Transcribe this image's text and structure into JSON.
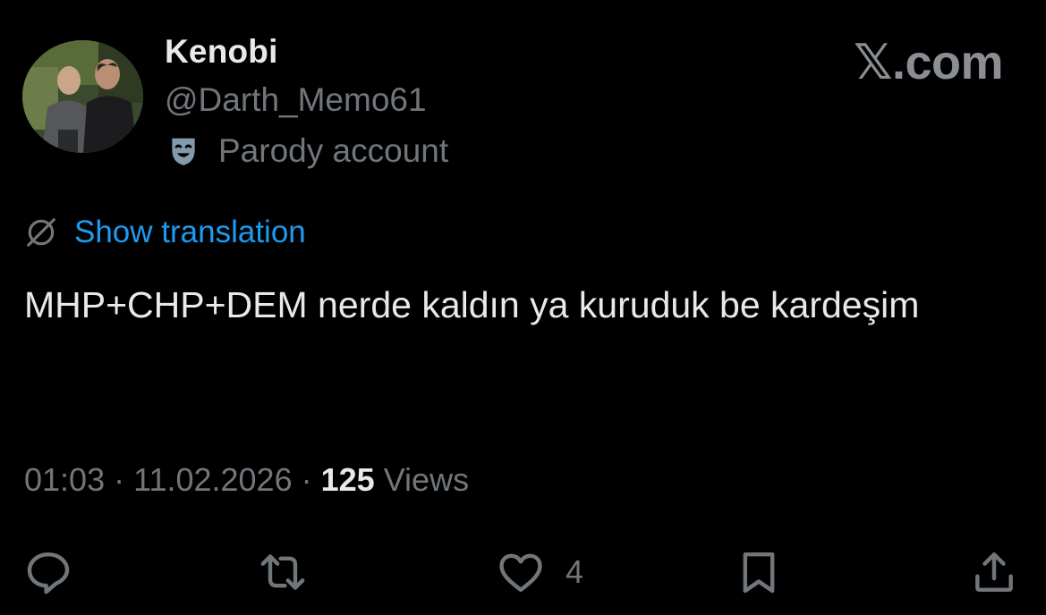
{
  "author": {
    "name": "Kenobi",
    "handle": "@Darth_Memo61",
    "badge_label": "Parody account",
    "avatar": "profile-photo"
  },
  "brand": {
    "watermark": "𝕏.com"
  },
  "translation": {
    "label": "Show translation",
    "icon": "globe-off-icon"
  },
  "tweet": {
    "text": "MHP+CHP+DEM nerde kaldın ya kuruduk be kardeşim"
  },
  "meta": {
    "time": "01:03",
    "separator1": " · ",
    "date": "11.02.2026",
    "separator2": " · ",
    "views_count": "125",
    "views_label": " Views"
  },
  "actions": {
    "reply": {
      "icon": "reply-icon"
    },
    "retweet": {
      "icon": "retweet-icon"
    },
    "like": {
      "icon": "heart-icon",
      "count": "4"
    },
    "bookmark": {
      "icon": "bookmark-icon"
    },
    "share": {
      "icon": "share-icon"
    }
  },
  "colors": {
    "background": "#000000",
    "text": "#e7e9ea",
    "muted": "#71767b",
    "link": "#1d9bf0"
  }
}
